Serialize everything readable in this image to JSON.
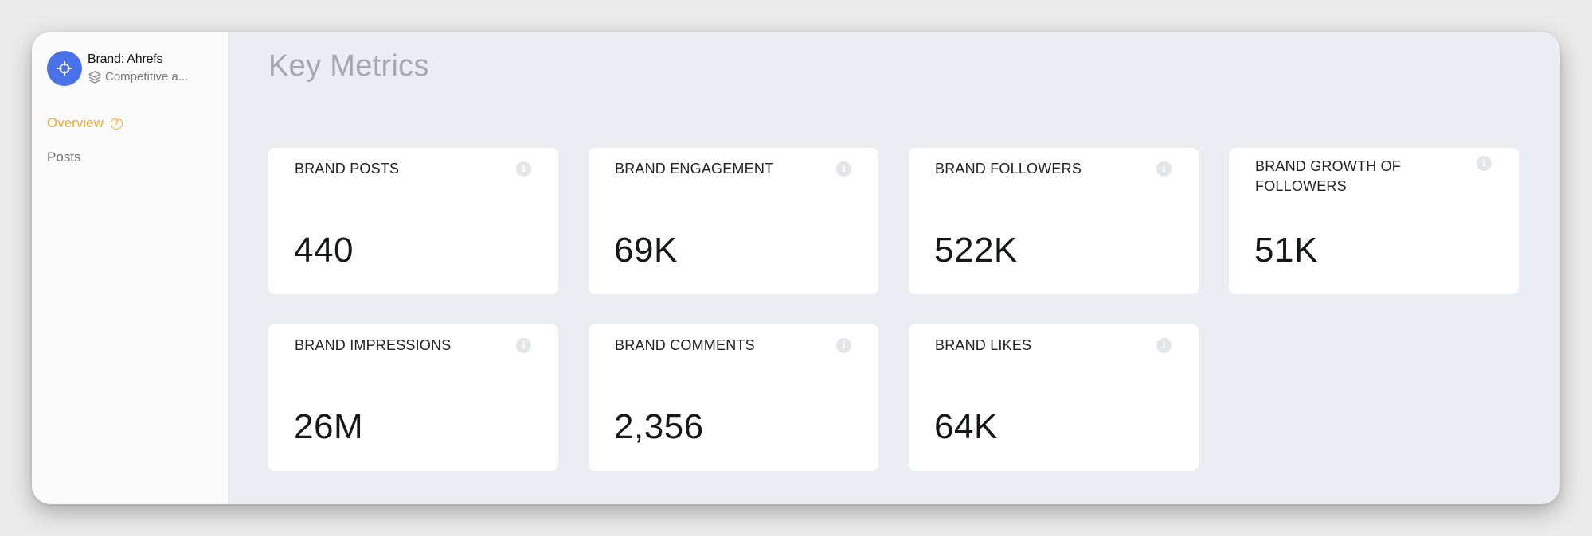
{
  "sidebar": {
    "brand_name": "Brand: Ahrefs",
    "brand_sub": "Competitive a...",
    "nav": [
      {
        "label": "Overview",
        "active": true
      },
      {
        "label": "Posts",
        "active": false
      }
    ]
  },
  "main": {
    "title": "Key Metrics",
    "cards": [
      {
        "label": "BRAND POSTS",
        "value": "440"
      },
      {
        "label": "BRAND ENGAGEMENT",
        "value": "69K"
      },
      {
        "label": "BRAND FOLLOWERS",
        "value": "522K"
      },
      {
        "label": "BRAND GROWTH OF FOLLOWERS",
        "value": "51K"
      },
      {
        "label": "BRAND IMPRESSIONS",
        "value": "26M"
      },
      {
        "label": "BRAND COMMENTS",
        "value": "2,356"
      },
      {
        "label": "BRAND LIKES",
        "value": "64K"
      }
    ]
  },
  "colors": {
    "accent": "#f0a935",
    "avatar": "#4a72e8",
    "main_bg": "#eaedf2",
    "sidebar_bg": "#fbfbfb"
  },
  "icons": {
    "brand": "crosshair-icon",
    "sub": "layers-icon",
    "help": "question-icon",
    "info": "info-icon"
  }
}
